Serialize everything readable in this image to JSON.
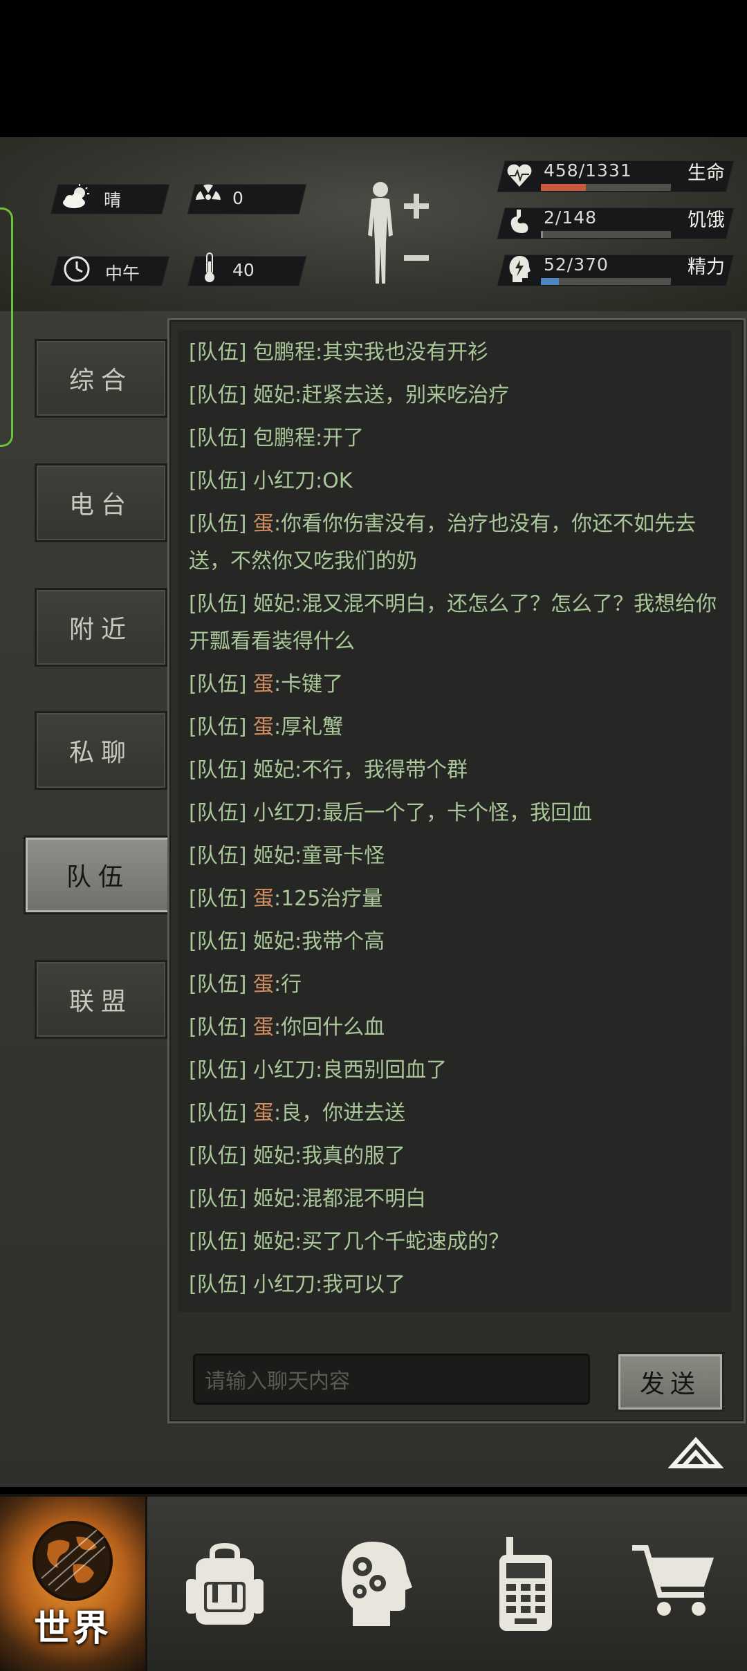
{
  "status": {
    "weather": {
      "label": "晴",
      "icon": "cloud-sun-icon"
    },
    "radiation": {
      "value": "0",
      "icon": "radiation-icon"
    },
    "time": {
      "label": "中午",
      "icon": "clock-icon"
    },
    "temperature": {
      "value": "40",
      "icon": "thermometer-icon"
    },
    "health": {
      "value": "458/1331",
      "label": "生命",
      "current": 458,
      "max": 1331,
      "color": "#c8583e"
    },
    "hunger": {
      "value": "2/148",
      "label": "饥饿",
      "current": 2,
      "max": 148,
      "color": "#888880"
    },
    "energy": {
      "value": "52/370",
      "label": "精力",
      "current": 52,
      "max": 370,
      "color": "#4f86c2"
    }
  },
  "tabs": [
    {
      "label": "综合",
      "active": false
    },
    {
      "label": "电台",
      "active": false
    },
    {
      "label": "附近",
      "active": false
    },
    {
      "label": "私聊",
      "active": false
    },
    {
      "label": "队伍",
      "active": true
    },
    {
      "label": "联盟",
      "active": false
    }
  ],
  "chat": {
    "tag": "[队伍]",
    "messages": [
      {
        "sender": "包鹏程",
        "text": ":其实我也没有开衫",
        "alt": false
      },
      {
        "sender": "姬妃",
        "text": ":赶紧去送，别来吃治疗",
        "alt": false
      },
      {
        "sender": "包鹏程",
        "text": ":开了",
        "alt": false
      },
      {
        "sender": "小红刀",
        "text": ":OK",
        "alt": false
      },
      {
        "sender": "蛋",
        "text": ":你看你伤害没有，治疗也没有，你还不如先去送，不然你又吃我们的奶",
        "alt": true
      },
      {
        "sender": "姬妃",
        "text": ":混又混不明白，还怎么了？怎么了？我想给你开瓢看看装得什么",
        "alt": false
      },
      {
        "sender": "蛋",
        "text": ":卡键了",
        "alt": true
      },
      {
        "sender": "蛋",
        "text": ":厚礼蟹",
        "alt": true
      },
      {
        "sender": "姬妃",
        "text": ":不行，我得带个群",
        "alt": false
      },
      {
        "sender": "小红刀",
        "text": ":最后一个了，卡个怪，我回血",
        "alt": false
      },
      {
        "sender": "姬妃",
        "text": ":童哥卡怪",
        "alt": false
      },
      {
        "sender": "蛋",
        "text": ":125治疗量",
        "alt": true
      },
      {
        "sender": "姬妃",
        "text": ":我带个高",
        "alt": false
      },
      {
        "sender": "蛋",
        "text": ":行",
        "alt": true
      },
      {
        "sender": "蛋",
        "text": ":你回什么血",
        "alt": true
      },
      {
        "sender": "小红刀",
        "text": ":良西别回血了",
        "alt": false
      },
      {
        "sender": "蛋",
        "text": ":良，你进去送",
        "alt": true
      },
      {
        "sender": "姬妃",
        "text": ":我真的服了",
        "alt": false
      },
      {
        "sender": "姬妃",
        "text": ":混都混不明白",
        "alt": false
      },
      {
        "sender": "姬妃",
        "text": ":买了几个千蛇速成的？",
        "alt": false
      },
      {
        "sender": "小红刀",
        "text": ":我可以了",
        "alt": false
      }
    ],
    "input_placeholder": "请输入聊天内容",
    "send_label": "发送"
  },
  "nav": {
    "world_label": "世界",
    "items": [
      "globe-icon",
      "backpack-icon",
      "skills-head-icon",
      "radio-phone-icon",
      "shopping-cart-icon"
    ]
  }
}
